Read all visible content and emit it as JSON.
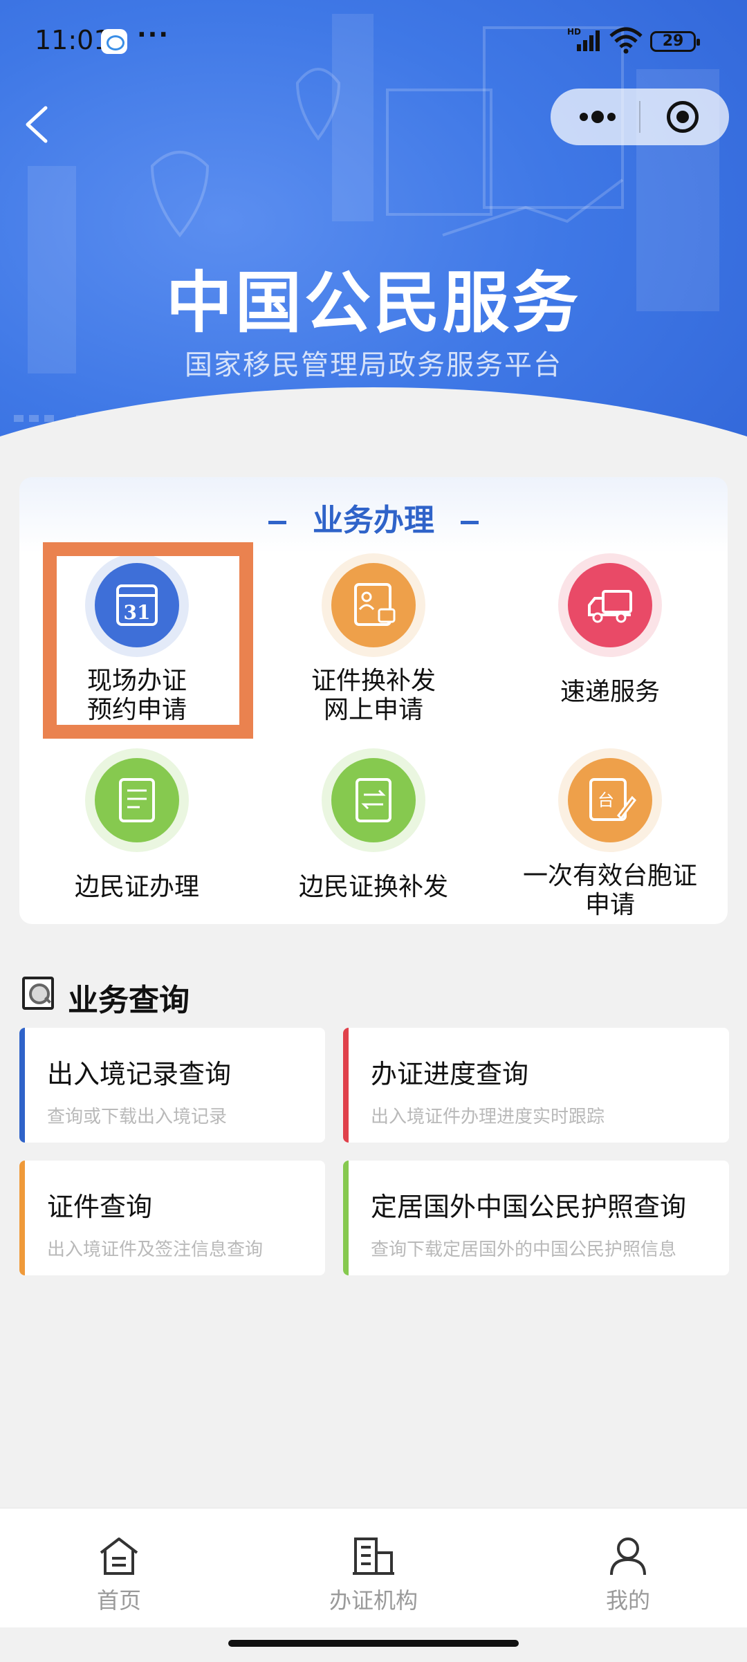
{
  "status_bar": {
    "time": "11:01",
    "more": "···",
    "battery": "29",
    "network": "HD"
  },
  "hero": {
    "title": "中国公民服务",
    "subtitle": "国家移民管理局政务服务平台"
  },
  "service_card": {
    "title": "业务办理",
    "items": [
      {
        "label": "现场办证\n预约申请",
        "icon": "calendar-icon",
        "color": "#3e6fd8"
      },
      {
        "label": "证件换补发\n网上申请",
        "icon": "id-card-icon",
        "color": "#eea04a"
      },
      {
        "label": "速递服务",
        "icon": "truck-icon",
        "color": "#e94a67"
      },
      {
        "label": "边民证办理",
        "icon": "document-icon",
        "color": "#86c94f"
      },
      {
        "label": "边民证换补发",
        "icon": "exchange-document-icon",
        "color": "#86c94f"
      },
      {
        "label": "一次有效台胞证\n申请",
        "icon": "taiwan-permit-icon",
        "color": "#eea04a"
      }
    ]
  },
  "query": {
    "title": "业务查询",
    "items": [
      {
        "title": "出入境记录查询",
        "subtitle": "查询或下载出入境记录",
        "color": "#2f63c9"
      },
      {
        "title": "办证进度查询",
        "subtitle": "出入境证件办理进度实时跟踪",
        "color": "#e0414b"
      },
      {
        "title": "证件查询",
        "subtitle": "出入境证件及签注信息查询",
        "color": "#ef9a3a"
      },
      {
        "title": "定居国外中国公民护照查询",
        "subtitle": "查询下载定居国外的中国公民护照信息",
        "color": "#86c94f"
      }
    ]
  },
  "tabbar": {
    "items": [
      {
        "label": "首页"
      },
      {
        "label": "办证机构"
      },
      {
        "label": "我的"
      }
    ]
  }
}
